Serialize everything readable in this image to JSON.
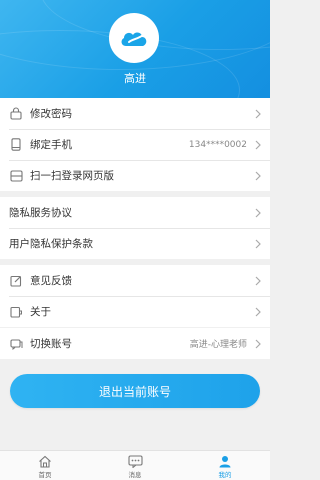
{
  "profile": {
    "name": "高进"
  },
  "groups": [
    {
      "items": [
        {
          "label": "修改密码",
          "value": ""
        },
        {
          "label": "绑定手机",
          "value": "134****0002"
        },
        {
          "label": "扫一扫登录网页版",
          "value": ""
        }
      ]
    },
    {
      "items": [
        {
          "label": "隐私服务协议",
          "value": ""
        },
        {
          "label": "用户隐私保护条款",
          "value": ""
        }
      ]
    },
    {
      "items": [
        {
          "label": "意见反馈",
          "value": ""
        },
        {
          "label": "关于",
          "value": ""
        }
      ]
    },
    {
      "items": [
        {
          "label": "切换账号",
          "value": "高进-心理老师"
        }
      ]
    }
  ],
  "logout_label": "退出当前账号",
  "tabs": [
    {
      "label": "首页",
      "icon": "home-icon"
    },
    {
      "label": "消息",
      "icon": "message-icon"
    },
    {
      "label": "我的",
      "icon": "user-icon",
      "active": true
    }
  ],
  "colors": {
    "accent": "#1a9fe6",
    "text": "#333333",
    "muted": "#888888"
  }
}
